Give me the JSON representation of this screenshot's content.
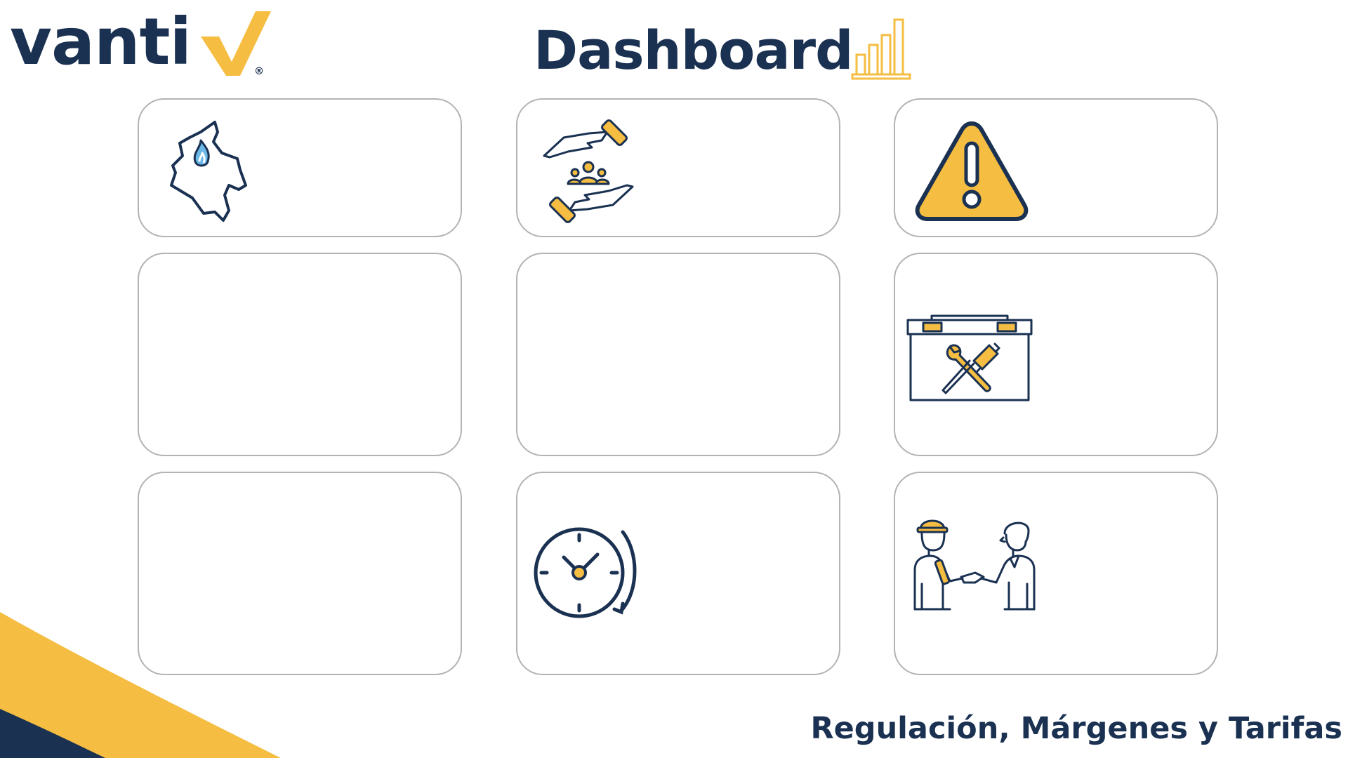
{
  "brand": {
    "name": "vanti",
    "registered_mark": "®",
    "primary_color": "#1a3152",
    "accent_color": "#f5bd41"
  },
  "header": {
    "title": "Dashboard",
    "title_icon": "bar-chart-icon"
  },
  "cards": [
    {
      "id": "gas-colombia",
      "icon": "colombia-gas-map-icon"
    },
    {
      "id": "community",
      "icon": "community-hands-icon"
    },
    {
      "id": "alert",
      "icon": "warning-triangle-icon"
    },
    {
      "id": "empty-1",
      "icon": ""
    },
    {
      "id": "empty-2",
      "icon": ""
    },
    {
      "id": "maintenance",
      "icon": "toolbox-icon"
    },
    {
      "id": "empty-3",
      "icon": ""
    },
    {
      "id": "time",
      "icon": "clock-rotate-icon"
    },
    {
      "id": "agreement",
      "icon": "handshake-workers-icon"
    }
  ],
  "footer": {
    "subtitle": "Regulación, Márgenes y Tarifas"
  }
}
